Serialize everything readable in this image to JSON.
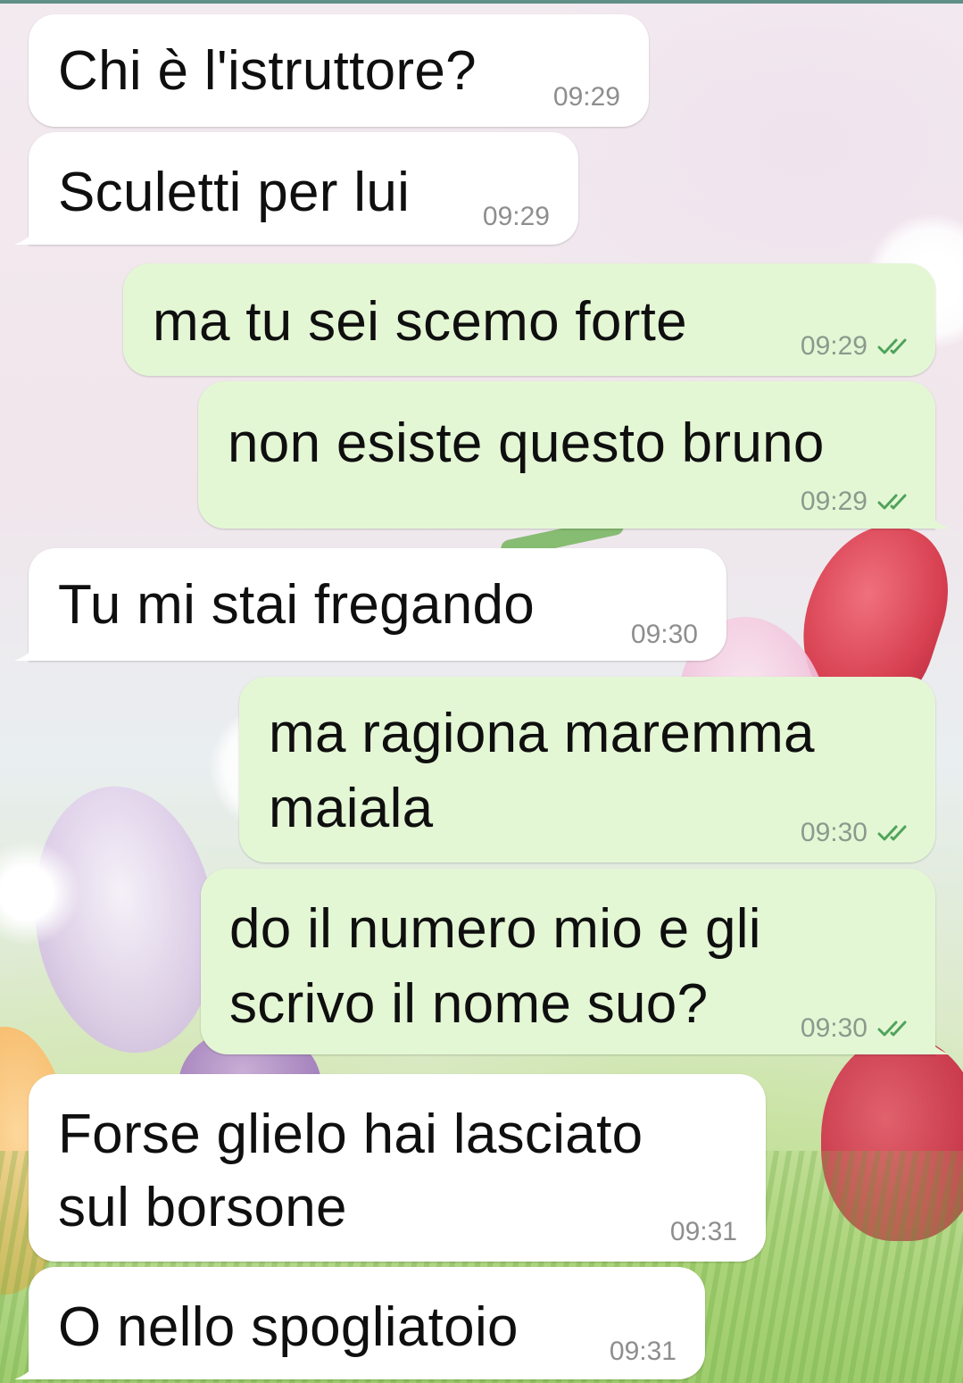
{
  "conversation": {
    "messages": [
      {
        "direction": "incoming",
        "lines": [
          "Chi è l'istruttore?"
        ],
        "time": "09:29"
      },
      {
        "direction": "incoming",
        "lines": [
          "Sculetti per lui"
        ],
        "time": "09:29"
      },
      {
        "direction": "outgoing",
        "lines": [
          "ma tu sei scemo forte"
        ],
        "time": "09:29",
        "status": "read"
      },
      {
        "direction": "outgoing",
        "lines": [
          "non esiste questo bruno"
        ],
        "time": "09:29",
        "status": "read"
      },
      {
        "direction": "incoming",
        "lines": [
          "Tu mi stai fregando"
        ],
        "time": "09:30"
      },
      {
        "direction": "outgoing",
        "lines": [
          "ma ragiona maremma",
          "maiala"
        ],
        "time": "09:30",
        "status": "read"
      },
      {
        "direction": "outgoing",
        "lines": [
          "do il numero mio e gli",
          "scrivo il nome suo?"
        ],
        "time": "09:30",
        "status": "read"
      },
      {
        "direction": "incoming",
        "lines": [
          "Forse glielo hai lasciato",
          "sul borsone"
        ],
        "time": "09:31"
      },
      {
        "direction": "incoming",
        "lines": [
          "O nello spogliatoio"
        ],
        "time": "09:31"
      }
    ]
  },
  "icons": {
    "read_receipt": "double-check-icon"
  },
  "colors": {
    "incoming_bubble": "#ffffff",
    "outgoing_bubble": "#e4f7d5",
    "read_ticks": "#4fa35a",
    "timestamp": "#8e8e8e"
  }
}
